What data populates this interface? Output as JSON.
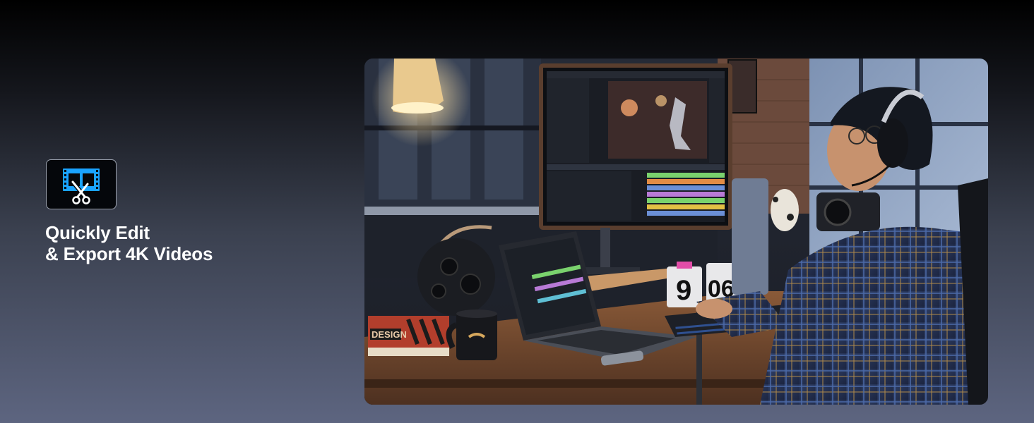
{
  "feature": {
    "icon": "video-edit-icon",
    "title_line_1": "Quickly Edit",
    "title_line_2": "& Export 4K Videos"
  },
  "photo": {
    "box_label": "DESIGN",
    "clock_hour": "9",
    "clock_minute": "06"
  },
  "colors": {
    "icon_blue": "#1aa3ff",
    "icon_border": "#9aa0ad",
    "title": "#ffffff"
  }
}
